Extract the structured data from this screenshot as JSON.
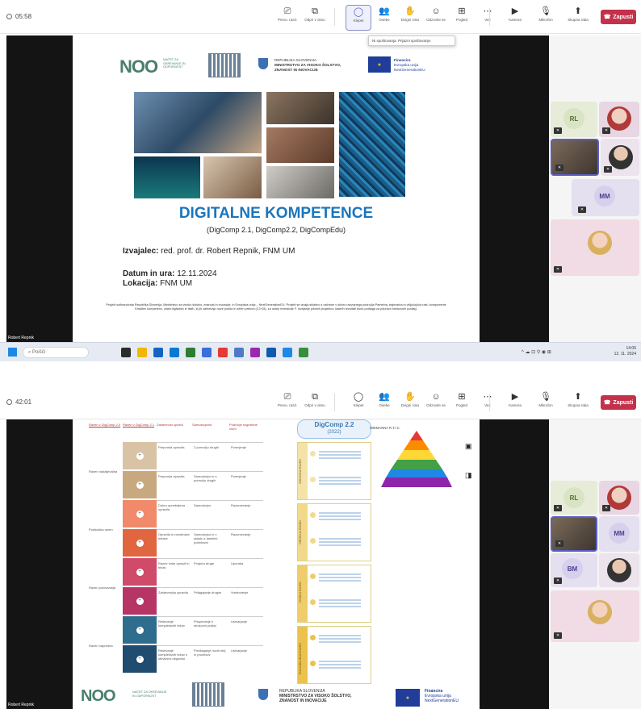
{
  "shot1": {
    "timer": "05:58",
    "toolbar": [
      {
        "label": "Prevo. razd.",
        "icon": "screen-icon"
      },
      {
        "label": "Odpri v oknu",
        "icon": "popout-icon"
      },
      {
        "label": "Klepet",
        "icon": "chat-icon"
      },
      {
        "label": "Osebe",
        "icon": "people-icon"
      },
      {
        "label": "Dvigni roko",
        "icon": "hand-icon"
      },
      {
        "label": "Odzovite se",
        "icon": "react-icon"
      },
      {
        "label": "Pogled",
        "icon": "view-icon"
      },
      {
        "label": "Več",
        "icon": "more-icon"
      },
      {
        "label": "Kamera",
        "icon": "camera-icon"
      },
      {
        "label": "Mikrofon",
        "icon": "mic-icon"
      },
      {
        "label": "Skupna raba",
        "icon": "share-icon"
      }
    ],
    "leave": "Zapusti",
    "tooltip": "Ni spoštovanja. Prijazni spoštovanje.",
    "slide": {
      "logo": "NOO",
      "logo_sub": "NAČRT ZA OKREVANJE IN ODPORNOST",
      "ministry_line1": "REPUBLIKA SLOVENIJA",
      "ministry_line2": "MINISTRSTVO ZA VISOKO ŠOLSTVO,",
      "ministry_line3": "ZNANOST IN INOVACIJE",
      "eu_line1": "Financira",
      "eu_line2": "Evropska unija",
      "eu_line3": "NextGenerationEU",
      "title": "DIGITALNE KOMPETENCE",
      "subtitle": "(DigComp 2.1, DigComp2.2, DigCompEdu)",
      "lecturer_label": "Izvajalec:",
      "lecturer": "red. prof. dr. Robert Repnik, FNM UM",
      "date_label": "Datum in ura:",
      "date": "12.11.2024",
      "location_label": "Lokacija:",
      "location": "FNM UM",
      "footer": "Projekt sofinancirata Republika Slovenija, Ministrstvo za visoko šolstvo, znanost in inovacije, in Evropska unija – NextGenerationEU. Projekt se izvaja skladno z načrtom v okviru razvojnega področja Pametna, trajnostna in vključujoča rast, komponente Krepitev kompetenc, zlasti digitalnih in tistih, ki jih zahtevajo nove poklici in zelen prehod (C3 K5), za ukrep investicije F. Izvajanje pilotnih projektov, katerih rezultati bodo podlaga za pripravo strokovnih podlag."
    },
    "presenter": "Robert Repnik",
    "participants": [
      "RL",
      "MM"
    ],
    "taskbar": {
      "search": "Poišči",
      "time": "14:05",
      "date": "12. 11. 2024"
    }
  },
  "shot2": {
    "timer": "42:01",
    "toolbar": [
      {
        "label": "Prevo. razd.",
        "icon": "screen-icon"
      },
      {
        "label": "Odpri v oknu",
        "icon": "popout-icon"
      },
      {
        "label": "Klepet",
        "icon": "chat-icon"
      },
      {
        "label": "Osebe",
        "icon": "people-icon"
      },
      {
        "label": "Dvigni roko",
        "icon": "hand-icon"
      },
      {
        "label": "Odzovite se",
        "icon": "react-icon"
      },
      {
        "label": "Pogled",
        "icon": "view-icon"
      },
      {
        "label": "Več",
        "icon": "more-icon"
      },
      {
        "label": "Kamera",
        "icon": "camera-icon"
      },
      {
        "label": "Mikrofon",
        "icon": "mic-icon"
      },
      {
        "label": "Skupna raba",
        "icon": "share-icon"
      }
    ],
    "people_count": "7",
    "leave": "Zapusti",
    "table_headers": [
      "Raven v DigComp 2.0",
      "Raven v DigComp 2.1",
      "Zahtevnost opravil",
      "Samostojnost",
      "Področje kognitivne ravni"
    ],
    "groups": [
      "Raven nadaljevalna",
      "Podšolska raven",
      "Raven poznavanja",
      "Raven napredna"
    ],
    "rows": [
      {
        "a": "Preprosta opravila",
        "b": "Z pomočjo drugih",
        "c": "Pomnjenje"
      },
      {
        "a": "Preprosta opravila",
        "b": "Samostojno in s pomočjo drugih",
        "c": "Pomnjenje"
      },
      {
        "a": "Dobro opredeljena opravila",
        "b": "Samostojno",
        "c": "Razumevanje"
      },
      {
        "a": "Opravila in nerutinske težave",
        "b": "Samostojno in v skladu z lastnimi potrebami",
        "c": "Razumevanje"
      },
      {
        "a": "Razne vrste opravil in težav",
        "b": "Podpira druge",
        "c": "Uporaba"
      },
      {
        "a": "Zahtevnejša opravila",
        "b": "Prilagajanje drugim",
        "c": "Vrednotenje"
      },
      {
        "a": "Reševanje kompleksnih težav",
        "b": "Prispevanje k strokovni praksi",
        "c": "Ustvarjanje"
      },
      {
        "a": "Reševanje kompleksnih težav s številnimi dejavniki",
        "b": "Predlaganje novih idej in procesov",
        "c": "Ustvarjanje"
      }
    ],
    "digcomp_title": "DigComp 2.2",
    "digcomp_year": "(2022)",
    "side_labels": [
      "OSNOVNA RAVEN",
      "SREDNJA RAVEN",
      "VISOKA RAVEN",
      "POGLOBLJENA RAVEN"
    ],
    "pyramid_title": "WIEMANNA R.T.I.C.",
    "slide_bottom": {
      "logo": "NOO",
      "logo_sub": "NAČRT ZA OKREVANJE IN ODPORNOST",
      "ministry_line1": "REPUBLIKA SLOVENIJA",
      "ministry_line2": "MINISTRSTVO ZA VISOKO ŠOLSTVO,",
      "ministry_line3": "ZNANOST IN INOVACIJE",
      "eu_line1": "Financira",
      "eu_line2": "Evropska unija",
      "eu_line3": "NextGenerationEU"
    },
    "presenter": "Robert Repnik",
    "participants": [
      "RL",
      "MM",
      "BM"
    ]
  }
}
